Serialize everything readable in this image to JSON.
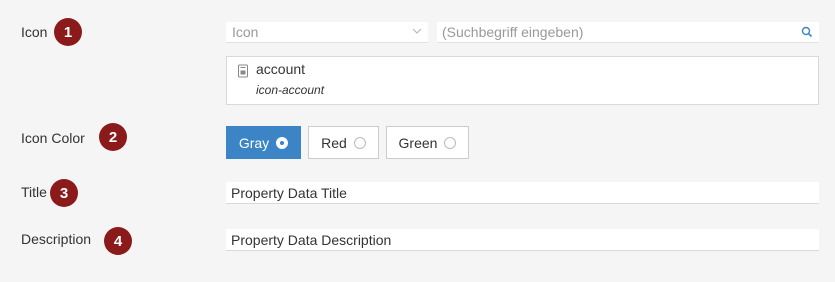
{
  "rows": {
    "icon": {
      "label": "Icon",
      "badge": "1",
      "select_value": "Icon",
      "search_placeholder": "(Suchbegriff eingeben)",
      "selected_icon": {
        "name": "account",
        "class_name": "icon-account"
      }
    },
    "icon_color": {
      "label": "Icon Color",
      "badge": "2",
      "options": [
        {
          "label": "Gray",
          "selected": true
        },
        {
          "label": "Red",
          "selected": false
        },
        {
          "label": "Green",
          "selected": false
        }
      ]
    },
    "title": {
      "label": "Title",
      "badge": "3",
      "value": "Property Data Title"
    },
    "description": {
      "label": "Description",
      "badge": "4",
      "value": "Property Data Description"
    }
  },
  "colors": {
    "accent": "#3b84c6",
    "badge": "#8b1a1a",
    "background": "#f5f5f5"
  },
  "icons": [
    "chevron-down-icon",
    "search-icon",
    "account-icon"
  ]
}
